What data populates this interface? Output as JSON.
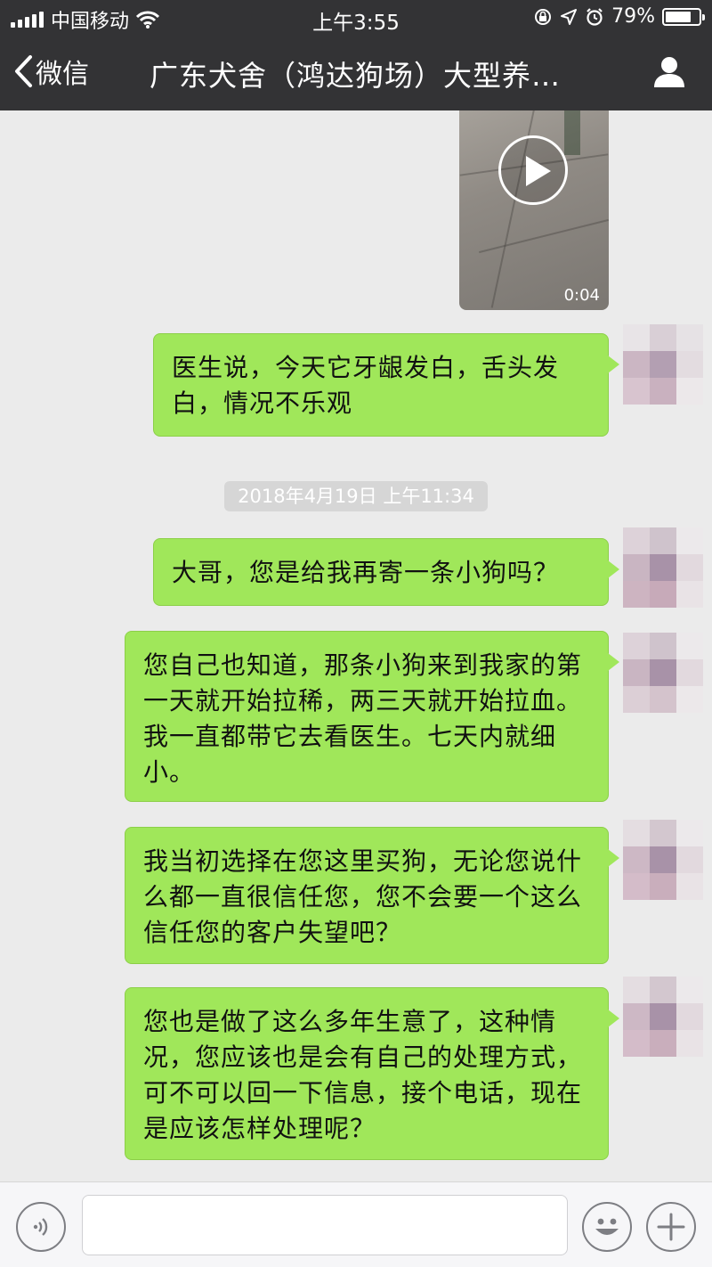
{
  "status_bar": {
    "carrier": "中国移动",
    "time": "上午3:55",
    "battery_percent": "79%",
    "battery_level": 0.79,
    "icons": [
      "signal-icon",
      "wifi-icon",
      "orientation-lock-icon",
      "location-icon",
      "alarm-icon",
      "battery-icon"
    ]
  },
  "nav": {
    "back_label": "微信",
    "title": "广东犬舍（鸿达狗场）大型养…",
    "profile_icon": "person-icon"
  },
  "video_message": {
    "duration": "0:04",
    "icon": "play-icon"
  },
  "timestamp": "2018年4月19日 上午11:34",
  "messages": [
    {
      "text": "医生说，今天它牙龈发白，舌头发白，情况不乐观"
    },
    {
      "text": "大哥，您是给我再寄一条小狗吗？"
    },
    {
      "text": "您自己也知道，那条小狗来到我家的第一天就开始拉稀，两三天就开始拉血。我一直都带它去看医生。七天内就细小。"
    },
    {
      "text": "我当初选择在您这里买狗，无论您说什么都一直很信任您，您不会要一个这么信任您的客户失望吧？"
    },
    {
      "text": "您也是做了这么多年生意了，这种情况，您应该也是会有自己的处理方式，可不可以回一下信息，接个电话，现在是应该怎样处理呢？"
    }
  ],
  "colors": {
    "nav_background": "#333335",
    "chat_background": "#ebebeb",
    "bubble_sent": "#a0e75a",
    "input_bar": "#f6f6f8"
  },
  "input_bar": {
    "voice_icon": "voice-icon",
    "input_value": "",
    "emoji_icon": "emoji-icon",
    "more_icon": "plus-icon"
  }
}
